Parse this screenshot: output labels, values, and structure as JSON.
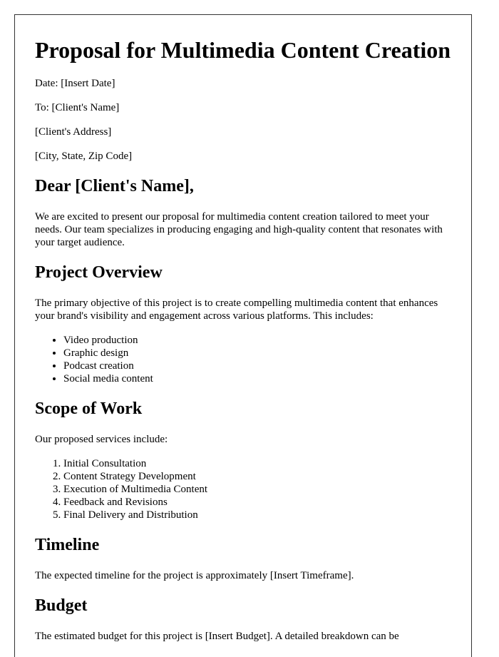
{
  "title": "Proposal for Multimedia Content Creation",
  "header": {
    "date": "Date: [Insert Date]",
    "to": "To: [Client's Name]",
    "address": "[Client's Address]",
    "city": "[City, State, Zip Code]"
  },
  "salutation": "Dear [Client's Name],",
  "intro": "We are excited to present our proposal for multimedia content creation tailored to meet your needs. Our team specializes in producing engaging and high-quality content that resonates with your target audience.",
  "overview": {
    "heading": "Project Overview",
    "text": "The primary objective of this project is to create compelling multimedia content that enhances your brand's visibility and engagement across various platforms. This includes:",
    "items": [
      "Video production",
      "Graphic design",
      "Podcast creation",
      "Social media content"
    ]
  },
  "scope": {
    "heading": "Scope of Work",
    "text": "Our proposed services include:",
    "items": [
      "Initial Consultation",
      "Content Strategy Development",
      "Execution of Multimedia Content",
      "Feedback and Revisions",
      "Final Delivery and Distribution"
    ]
  },
  "timeline": {
    "heading": "Timeline",
    "text": "The expected timeline for the project is approximately [Insert Timeframe]."
  },
  "budget": {
    "heading": "Budget",
    "text": "The estimated budget for this project is [Insert Budget]. A detailed breakdown can be"
  }
}
